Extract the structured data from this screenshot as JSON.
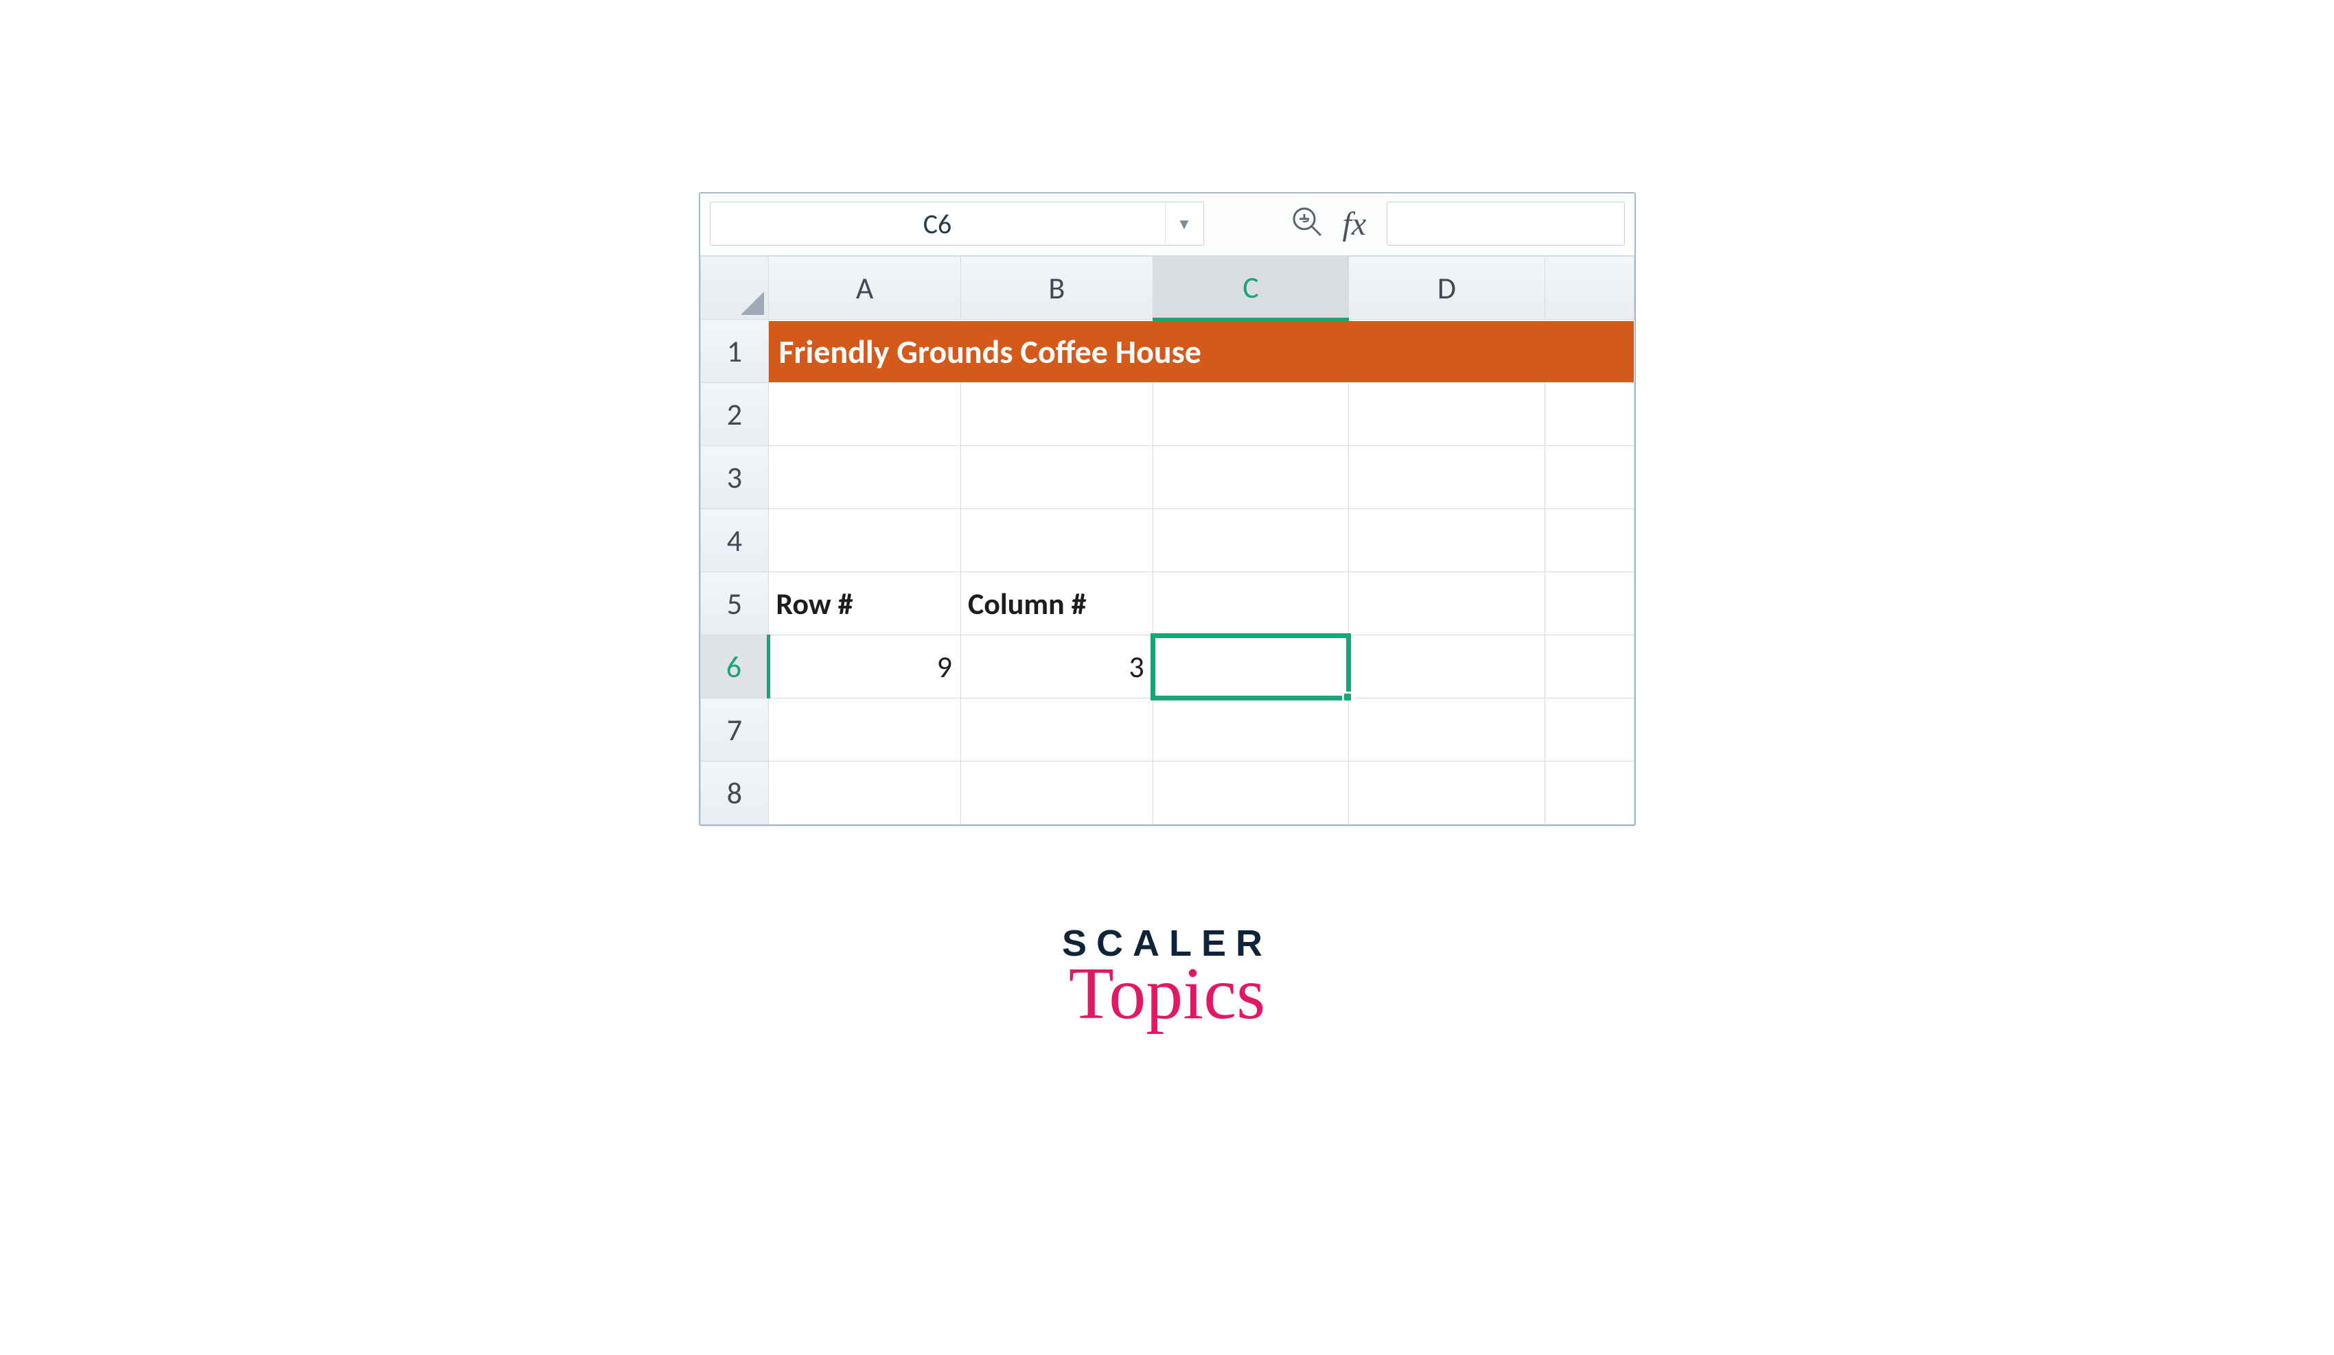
{
  "toolbar": {
    "namebox": "C6",
    "fx_label": "fx"
  },
  "columns": [
    "A",
    "B",
    "C",
    "D",
    ""
  ],
  "active_column_index": 2,
  "rows": [
    "1",
    "2",
    "3",
    "4",
    "5",
    "6",
    "7",
    "8"
  ],
  "active_row_index": 5,
  "title_text": "Friendly Grounds Coffee House",
  "labels": {
    "row5_A": "Row #",
    "row5_B": "Column #"
  },
  "values": {
    "row6_A": "9",
    "row6_B": "3"
  },
  "logo": {
    "line1": "SCALER",
    "line2": "Topics"
  },
  "chart_data": {
    "type": "table",
    "title": "Friendly Grounds Coffee House",
    "headers_row": 5,
    "headers": [
      "Row #",
      "Column #"
    ],
    "data": [
      {
        "Row #": 9,
        "Column #": 3
      }
    ],
    "active_cell": "C6"
  }
}
